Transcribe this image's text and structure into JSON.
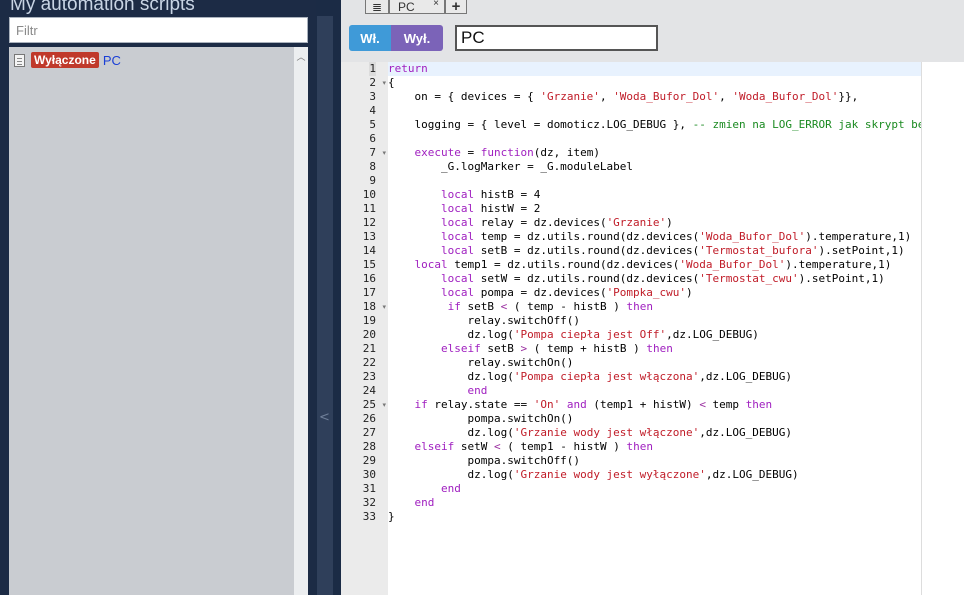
{
  "left_panel": {
    "title": "My automation scripts",
    "filter_placeholder": "Filtr",
    "scripts": [
      {
        "status_badge": "Wyłączone",
        "name": "PC",
        "status_color": "#c0392b",
        "icon": "document-icon"
      }
    ]
  },
  "splitter": {
    "icon": "chevron-left-icon",
    "glyph": "<"
  },
  "tabs": {
    "list_icon": "list-icon",
    "list_glyph": "≣",
    "active_tab": "PC",
    "close_glyph": "×",
    "add_glyph": "+"
  },
  "toolbar": {
    "on_label": "Wł.",
    "off_label": "Wył.",
    "script_name_value": "PC",
    "on_color": "#3f9ad8",
    "off_color": "#7b63b8"
  },
  "editor": {
    "language": "lua",
    "active_line": 1,
    "folds": [
      2,
      7,
      18,
      25
    ],
    "fold_glyph": "▾",
    "lines": [
      [
        [
          "kw",
          "return"
        ]
      ],
      [
        [
          "",
          "{"
        ]
      ],
      [
        [
          "",
          "    on = { devices = { "
        ],
        [
          "str",
          "'Grzanie'"
        ],
        [
          "",
          ", "
        ],
        [
          "str",
          "'Woda_Bufor_Dol'"
        ],
        [
          "",
          ", "
        ],
        [
          "str",
          "'Woda_Bufor_Dol'"
        ],
        [
          "",
          "}},"
        ]
      ],
      [
        [
          "",
          ""
        ]
      ],
      [
        [
          "",
          "    logging = { level = domoticz.LOG_DEBUG }, "
        ],
        [
          "cm",
          "-- zmien na LOG_ERROR jak skrypt bedzie d"
        ]
      ],
      [
        [
          "",
          ""
        ]
      ],
      [
        [
          "",
          "    "
        ],
        [
          "kw",
          "execute"
        ],
        [
          "",
          " = "
        ],
        [
          "kw",
          "function"
        ],
        [
          "",
          "(dz, item)"
        ]
      ],
      [
        [
          "",
          "        _G.logMarker = _G.moduleLabel"
        ]
      ],
      [
        [
          "",
          ""
        ]
      ],
      [
        [
          "",
          "        "
        ],
        [
          "kw",
          "local"
        ],
        [
          "",
          " histB = 4"
        ]
      ],
      [
        [
          "",
          "        "
        ],
        [
          "kw",
          "local"
        ],
        [
          "",
          " histW = 2"
        ]
      ],
      [
        [
          "",
          "        "
        ],
        [
          "kw",
          "local"
        ],
        [
          "",
          " relay = dz.devices("
        ],
        [
          "str",
          "'Grzanie'"
        ],
        [
          "",
          ")"
        ]
      ],
      [
        [
          "",
          "        "
        ],
        [
          "kw",
          "local"
        ],
        [
          "",
          " temp = dz.utils.round(dz.devices("
        ],
        [
          "str",
          "'Woda_Bufor_Dol'"
        ],
        [
          "",
          ").temperature,1)"
        ]
      ],
      [
        [
          "",
          "        "
        ],
        [
          "kw",
          "local"
        ],
        [
          "",
          " setB = dz.utils.round(dz.devices("
        ],
        [
          "str",
          "'Termostat_bufora'"
        ],
        [
          "",
          ").setPoint,1)"
        ]
      ],
      [
        [
          "",
          "    "
        ],
        [
          "kw",
          "local"
        ],
        [
          "",
          " temp1 = dz.utils.round(dz.devices("
        ],
        [
          "str",
          "'Woda_Bufor_Dol'"
        ],
        [
          "",
          ").temperature,1)"
        ]
      ],
      [
        [
          "",
          "        "
        ],
        [
          "kw",
          "local"
        ],
        [
          "",
          " setW = dz.utils.round(dz.devices("
        ],
        [
          "str",
          "'Termostat_cwu'"
        ],
        [
          "",
          ").setPoint,1)"
        ]
      ],
      [
        [
          "",
          "        "
        ],
        [
          "kw",
          "local"
        ],
        [
          "",
          " pompa = dz.devices("
        ],
        [
          "str",
          "'Pompka_cwu'"
        ],
        [
          "",
          ")"
        ]
      ],
      [
        [
          "",
          "         "
        ],
        [
          "kw",
          "if"
        ],
        [
          "",
          " setB "
        ],
        [
          "op",
          "<"
        ],
        [
          "",
          " ( temp - histB ) "
        ],
        [
          "kw",
          "then"
        ]
      ],
      [
        [
          "",
          "            relay.switchOff()"
        ]
      ],
      [
        [
          "",
          "            dz.log("
        ],
        [
          "str",
          "'Pompa ciepła jest Off'"
        ],
        [
          "",
          ",dz.LOG_DEBUG)"
        ]
      ],
      [
        [
          "",
          "        "
        ],
        [
          "kw",
          "elseif"
        ],
        [
          "",
          " setB "
        ],
        [
          "op",
          ">"
        ],
        [
          "",
          " ( temp + histB ) "
        ],
        [
          "kw",
          "then"
        ]
      ],
      [
        [
          "",
          "            relay.switchOn()"
        ]
      ],
      [
        [
          "",
          "            dz.log("
        ],
        [
          "str",
          "'Pompa ciepła jest włączona'"
        ],
        [
          "",
          ",dz.LOG_DEBUG)"
        ]
      ],
      [
        [
          "",
          "            "
        ],
        [
          "kw",
          "end"
        ]
      ],
      [
        [
          "",
          "    "
        ],
        [
          "kw",
          "if"
        ],
        [
          "",
          " relay.state == "
        ],
        [
          "str",
          "'On'"
        ],
        [
          "",
          " "
        ],
        [
          "kw",
          "and"
        ],
        [
          "",
          " (temp1 + histW) "
        ],
        [
          "op",
          "<"
        ],
        [
          "",
          " temp "
        ],
        [
          "kw",
          "then"
        ]
      ],
      [
        [
          "",
          "            pompa.switchOn()"
        ]
      ],
      [
        [
          "",
          "            dz.log("
        ],
        [
          "str",
          "'Grzanie wody jest włączone'"
        ],
        [
          "",
          ",dz.LOG_DEBUG)"
        ]
      ],
      [
        [
          "",
          "    "
        ],
        [
          "kw",
          "elseif"
        ],
        [
          "",
          " setW "
        ],
        [
          "op",
          "<"
        ],
        [
          "",
          " ( temp1 - histW ) "
        ],
        [
          "kw",
          "then"
        ]
      ],
      [
        [
          "",
          "            pompa.switchOff()"
        ]
      ],
      [
        [
          "",
          "            dz.log("
        ],
        [
          "str",
          "'Grzanie wody jest wyłączone'"
        ],
        [
          "",
          ",dz.LOG_DEBUG)"
        ]
      ],
      [
        [
          "",
          "        "
        ],
        [
          "kw",
          "end"
        ]
      ],
      [
        [
          "",
          "    "
        ],
        [
          "kw",
          "end"
        ]
      ],
      [
        [
          "",
          "}"
        ]
      ]
    ]
  }
}
